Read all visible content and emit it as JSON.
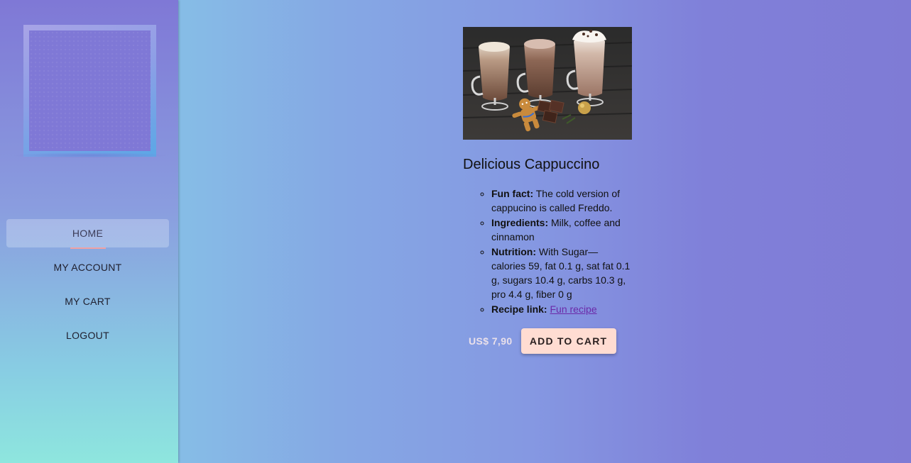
{
  "nav": {
    "items": [
      {
        "label": "HOME",
        "active": true
      },
      {
        "label": "MY ACCOUNT",
        "active": false
      },
      {
        "label": "MY CART",
        "active": false
      },
      {
        "label": "LOGOUT",
        "active": false
      }
    ]
  },
  "product": {
    "image_alt": "three cappuccino glasses with chocolate and gingerbread",
    "title": "Delicious Cappuccino",
    "facts": [
      {
        "label": "Fun fact:",
        "text": "The cold version of cappucino is called Freddo."
      },
      {
        "label": "Ingredients:",
        "text": "Milk, coffee and cinnamon"
      },
      {
        "label": "Nutrition:",
        "text": "With Sugar—calories 59, fat 0.1 g, sat fat 0.1 g, sugars 10.4 g, carbs 10.3 g, pro 4.4 g, fiber 0 g"
      },
      {
        "label": "Recipe link:",
        "link_text": "Fun recipe"
      }
    ],
    "price": "US$ 7,90",
    "add_to_cart_label": "ADD TO CART"
  },
  "colors": {
    "accent_button": "#ffdcd2",
    "active_underline": "#f0a1a3",
    "link": "#6b2aa8"
  }
}
